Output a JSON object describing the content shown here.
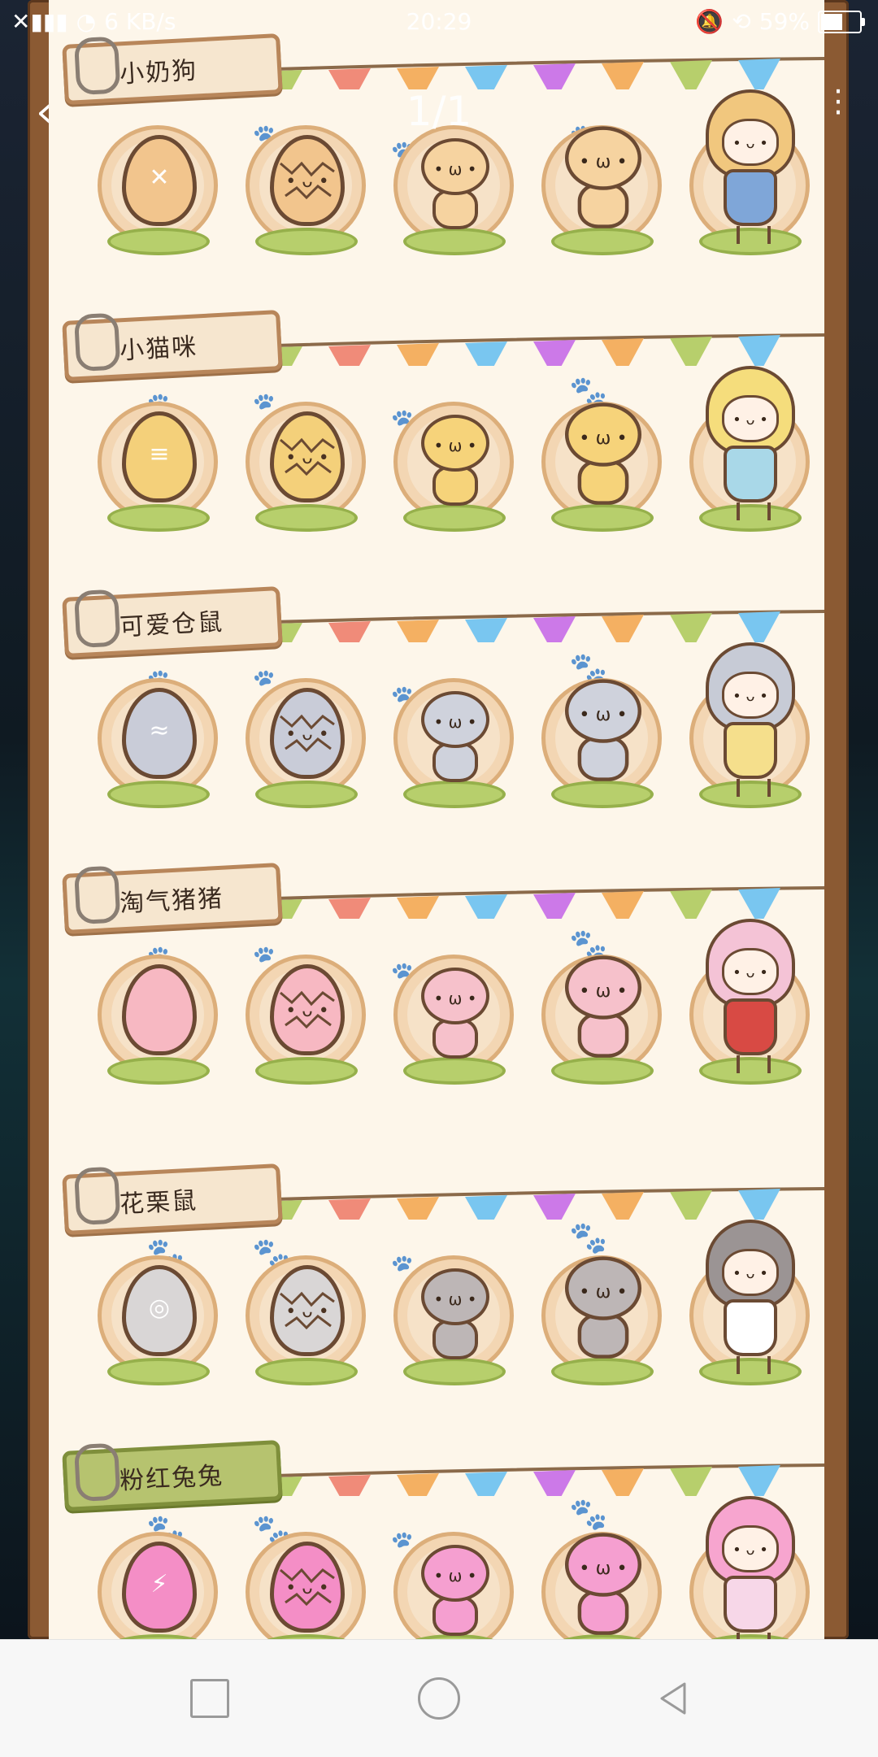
{
  "status_bar": {
    "network_speed": "6 KB/s",
    "time": "20:29",
    "battery_percent": "59%",
    "battery_level": 0.59,
    "icons": [
      "signal-icon",
      "wifi-icon",
      "mute-icon",
      "rotation-lock-icon",
      "battery-icon"
    ]
  },
  "viewer": {
    "page_indicator": "1/1",
    "back_icon": "back-arrow-icon",
    "more_icon": "more-vertical-icon"
  },
  "categories": [
    {
      "name": "小奶狗",
      "style": "tan",
      "colors": {
        "egg": "#f2c58d",
        "mark": "✕",
        "critter": "#f6d3a0",
        "girl_hair": "#f1c77e",
        "girl_dress": "#7fa6d8"
      }
    },
    {
      "name": "小猫咪",
      "style": "tan",
      "colors": {
        "egg": "#f4d07a",
        "mark": "≡",
        "critter": "#f6d37a",
        "girl_hair": "#f5dd7c",
        "girl_dress": "#a9d8e8"
      }
    },
    {
      "name": "可爱仓鼠",
      "style": "tan",
      "colors": {
        "egg": "#c9ccd8",
        "mark": "≈",
        "critter": "#cfd2dc",
        "girl_hair": "#c7cbd6",
        "girl_dress": "#f5df8c"
      }
    },
    {
      "name": "淘气猪猪",
      "style": "tan",
      "colors": {
        "egg": "#f7b8c2",
        "mark": "",
        "critter": "#f6c1cb",
        "girl_hair": "#f4c3d6",
        "girl_dress": "#d84a44"
      }
    },
    {
      "name": "花栗鼠",
      "style": "tan",
      "colors": {
        "egg": "#d9d6d6",
        "mark": "◎",
        "critter": "#bdb6b6",
        "girl_hair": "#9b9494",
        "girl_dress": "#ffffff"
      }
    },
    {
      "name": "粉红兔兔",
      "style": "green",
      "colors": {
        "egg": "#f48ec6",
        "mark": "⚡",
        "critter": "#f59fd0",
        "girl_hair": "#f7a5cf",
        "girl_dress": "#f7d7e8"
      }
    }
  ],
  "bottom_nav": {
    "icons": [
      "recent-apps-icon",
      "home-icon",
      "back-icon"
    ]
  }
}
